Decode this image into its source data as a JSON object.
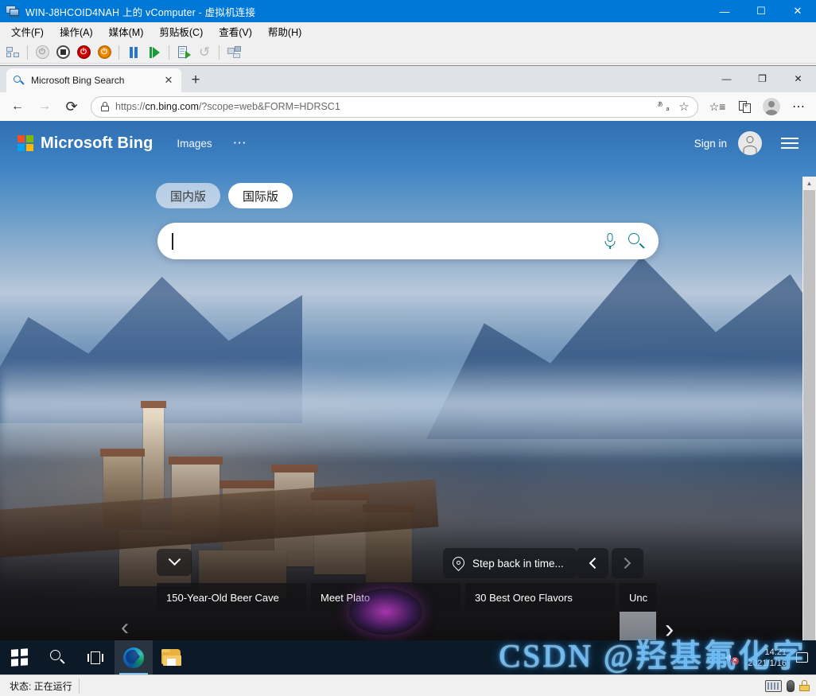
{
  "vm_window": {
    "title": "WIN-J8HCOID4NAH 上的 vComputer - 虚拟机连接",
    "icon": "virtual-machine-icon",
    "controls": {
      "minimize": "—",
      "maximize": "☐",
      "close": "✕"
    },
    "menu": [
      {
        "label": "文件(F)"
      },
      {
        "label": "操作(A)"
      },
      {
        "label": "媒体(M)"
      },
      {
        "label": "剪贴板(C)"
      },
      {
        "label": "查看(V)"
      },
      {
        "label": "帮助(H)"
      }
    ],
    "toolbar": [
      {
        "name": "ctrl-alt-delete-icon"
      },
      {
        "name": "start-icon"
      },
      {
        "name": "turn-off-icon"
      },
      {
        "name": "shutdown-icon"
      },
      {
        "name": "save-state-icon"
      },
      {
        "name": "pause-icon"
      },
      {
        "name": "resume-icon"
      },
      {
        "name": "checkpoint-icon"
      },
      {
        "name": "revert-icon"
      },
      {
        "name": "settings-icon"
      }
    ],
    "status": {
      "label": "状态: 正在运行"
    },
    "status_icons": [
      "keyboard-icon",
      "mouse-icon",
      "lock-icon"
    ]
  },
  "browser": {
    "tab": {
      "title": "Microsoft Bing Search",
      "favicon": "search-favicon",
      "close": "✕"
    },
    "new_tab_label": "+",
    "window_controls": {
      "minimize": "—",
      "maximize": "❐",
      "close": "✕"
    },
    "nav": {
      "back": "←",
      "forward": "→",
      "refresh": "⟳",
      "url_scheme": "https://",
      "url_domain": "cn.bing.com",
      "url_path": "/?scope=web&FORM=HDRSC1",
      "url_full": "https://cn.bing.com/?scope=web&FORM=HDRSC1",
      "lock_icon": "site-lock-icon",
      "translate_icon": "translate-icon",
      "favorite_icon": "star-icon",
      "favorites_list_icon": "favorites-list-icon",
      "collections_icon": "collections-icon",
      "profile_icon": "profile-avatar-icon",
      "settings_icon": "more-settings-icon",
      "settings_label": "⋯"
    }
  },
  "bing": {
    "logo_text": "Microsoft Bing",
    "nav_links": [
      {
        "label": "Images"
      }
    ],
    "more_label": "⋯",
    "sign_in_label": "Sign in",
    "hamburger_icon": "hamburger-menu-icon",
    "version_pills": [
      {
        "label": "国内版",
        "selected": false
      },
      {
        "label": "国际版",
        "selected": true
      }
    ],
    "search": {
      "value": "",
      "placeholder": "",
      "mic_icon": "microphone-icon",
      "search_icon": "search-icon"
    },
    "image_info": {
      "pin_icon": "location-pin-icon",
      "caption": "Step back in time...",
      "prev_label": "‹",
      "next_label": "›"
    },
    "expand_icon": "chevron-down-icon",
    "carousel": {
      "prev_label": "‹",
      "next_label": "›",
      "cards": [
        {
          "title": "150-Year-Old Beer Cave"
        },
        {
          "title": "Meet Plato"
        },
        {
          "title": "30 Best Oreo Flavors"
        },
        {
          "title": "Unc"
        }
      ]
    },
    "scrollbar": {
      "up_arrow": "▲"
    }
  },
  "taskbar": {
    "items": [
      {
        "name": "start-button",
        "label": "Start"
      },
      {
        "name": "taskbar-search-button",
        "label": "Search"
      },
      {
        "name": "task-view-button",
        "label": "Task View"
      },
      {
        "name": "edge-taskbar-button",
        "label": "Microsoft Edge",
        "active": true
      },
      {
        "name": "file-explorer-taskbar-button",
        "label": "File Explorer",
        "active": false
      }
    ],
    "tray": {
      "volume_icon": "volume-muted-icon",
      "time": "14:21",
      "date": "2021/1/16",
      "notification_icon": "notification-center-icon"
    },
    "watermark": "CSDN @羟基氟化字"
  },
  "colors": {
    "vm_titlebar": "#0078d7",
    "accent_blue": "#0f7c92",
    "taskbar": "#0c1c28",
    "watermark_neon": "#4fb0ff"
  }
}
